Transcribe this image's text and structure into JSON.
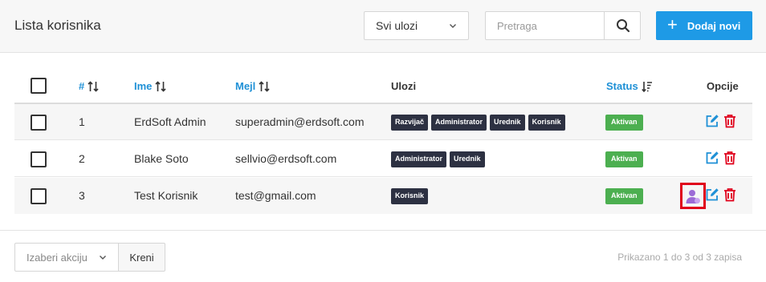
{
  "header": {
    "title": "Lista korisnika",
    "role_filter": "Svi ulozi",
    "search_placeholder": "Pretraga",
    "add_label": "Dodaj novi"
  },
  "table": {
    "columns": {
      "id": "#",
      "name": "Ime",
      "email": "Mejl",
      "roles": "Ulozi",
      "status": "Status",
      "options": "Opcije"
    },
    "rows": [
      {
        "id": "1",
        "name": "ErdSoft Admin",
        "email": "superadmin@erdsoft.com",
        "roles": [
          "Razvijač",
          "Administrator",
          "Urednik",
          "Korisnik"
        ],
        "status": "Aktivan"
      },
      {
        "id": "2",
        "name": "Blake Soto",
        "email": "sellvio@erdsoft.com",
        "roles": [
          "Administrator",
          "Urednik"
        ],
        "status": "Aktivan"
      },
      {
        "id": "3",
        "name": "Test Korisnik",
        "email": "test@gmail.com",
        "roles": [
          "Korisnik"
        ],
        "status": "Aktivan"
      }
    ]
  },
  "footer": {
    "bulk_action": "Izaberi akciju",
    "go_label": "Kreni",
    "pager_info": "Prikazano 1 do 3 od 3 zapisa"
  },
  "colors": {
    "accent": "#1e9ae6",
    "role_badge": "#2d3142",
    "status_active": "#4caf50",
    "delete": "#e0001b",
    "highlight": "#e0001b"
  },
  "icons": {
    "search": "search-icon",
    "add": "plus-icon",
    "sort": "sort-icon",
    "sort_desc": "sort-desc-icon",
    "edit": "edit-icon",
    "delete": "trash-icon",
    "impersonate": "user-impersonate-icon",
    "dropdown": "chevron-down-icon"
  }
}
